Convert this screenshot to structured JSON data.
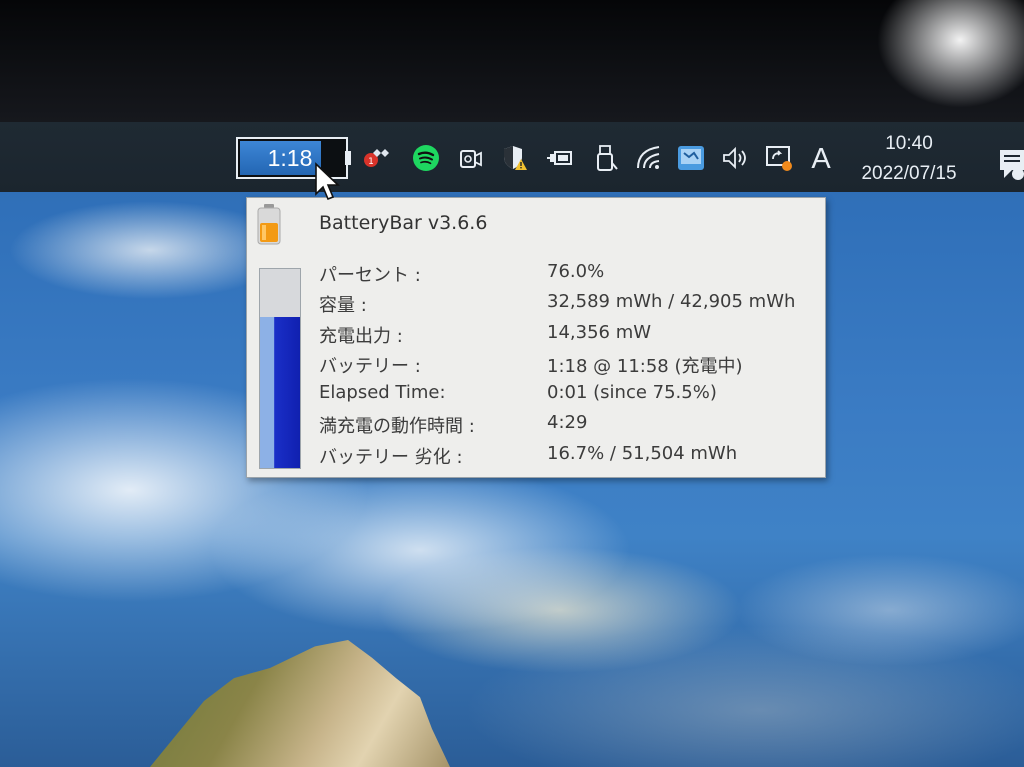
{
  "taskbar": {
    "batterybar": {
      "time_label": "1:18",
      "charge_fraction": 0.76
    },
    "tray_icons": [
      {
        "name": "batterycare-icon"
      },
      {
        "name": "spotify-icon"
      },
      {
        "name": "camera-icon"
      },
      {
        "name": "security-shield-warning-icon"
      },
      {
        "name": "power-plug-battery-icon"
      },
      {
        "name": "usb-eject-icon"
      },
      {
        "name": "wifi-icon"
      },
      {
        "name": "network-app-icon"
      },
      {
        "name": "volume-icon"
      },
      {
        "name": "backup-sync-icon"
      }
    ],
    "ime_indicator": "A",
    "clock": {
      "time": "10:40",
      "date": "2022/07/15"
    }
  },
  "popup": {
    "title": "BatteryBar v3.6.6",
    "gauge_fraction": 0.76,
    "rows": [
      {
        "label": "パーセント :",
        "value": "76.0%"
      },
      {
        "label": "容量 :",
        "value": "32,589 mWh / 42,905 mWh"
      },
      {
        "label": "充電出力 :",
        "value": "14,356 mW"
      },
      {
        "label": "バッテリー :",
        "value": "1:18 @ 11:58 (充電中)"
      },
      {
        "label": "Elapsed Time:",
        "value": "0:01 (since 75.5%)"
      },
      {
        "label": "満充電の動作時間 :",
        "value": "4:29"
      },
      {
        "label": "バッテリー 劣化 :",
        "value": "16.7% / 51,504 mWh"
      }
    ]
  },
  "colors": {
    "taskbar_bg": "#1d2730",
    "batterybar_fill": "#2d74c6",
    "popup_bg": "#eeeeec",
    "gauge_fill_dark": "#1020b0",
    "gauge_fill_light": "#8db1e6"
  }
}
